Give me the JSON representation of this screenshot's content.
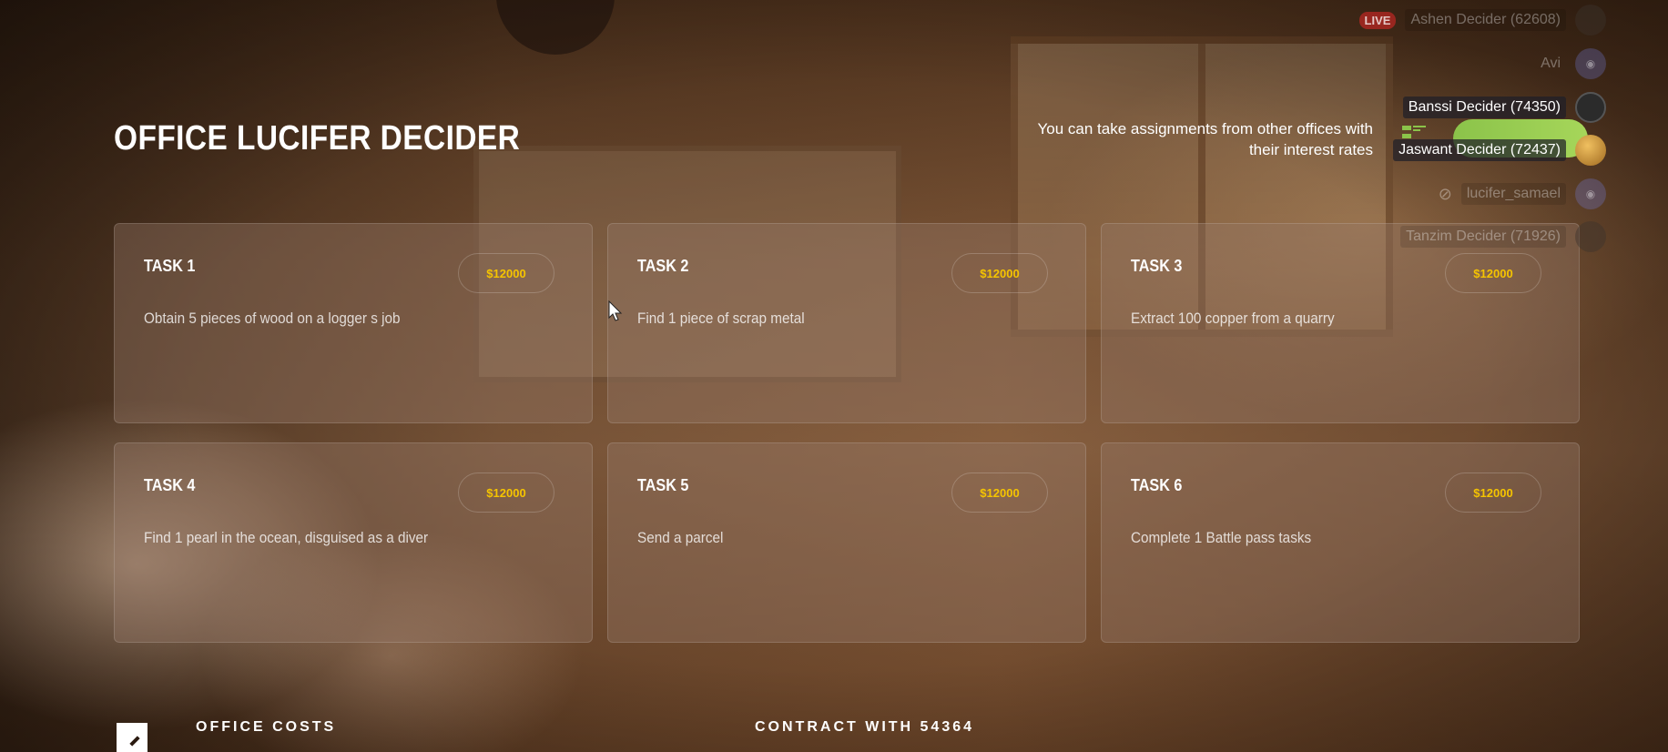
{
  "header": {
    "title": "OFFICE LUCIFER DECIDER",
    "info": "You can take assignments from other offices with their interest rates"
  },
  "tasks": [
    {
      "title": "TASK 1",
      "price": "$12000",
      "description": "Obtain 5 pieces of wood on a logger s job"
    },
    {
      "title": "TASK 2",
      "price": "$12000",
      "description": "Find 1 piece of scrap metal"
    },
    {
      "title": "TASK 3",
      "price": "$12000",
      "description": "Extract 100 copper from a quarry"
    },
    {
      "title": "TASK 4",
      "price": "$12000",
      "description": "Find 1 pearl in the ocean, disguised as a diver"
    },
    {
      "title": "TASK 5",
      "price": "$12000",
      "description": "Send a parcel"
    },
    {
      "title": "TASK 6",
      "price": "$12000",
      "description": "Complete 1 Battle pass tasks"
    }
  ],
  "footer": {
    "office_costs": "OFFICE COSTS",
    "contract": "CONTRACT WITH 54364"
  },
  "overlay": {
    "live": "LIVE",
    "users": [
      {
        "name": "Ashen Decider (62608)"
      },
      {
        "name": "Avi"
      },
      {
        "name": "Banssi Decider (74350)"
      },
      {
        "name": "Jaswant Decider (72437)"
      },
      {
        "name": "lucifer_samael"
      },
      {
        "name": "Tanzim Decider (71926)"
      }
    ]
  },
  "colors": {
    "price": "#f5c400",
    "accent_green": "#8bc34a"
  }
}
